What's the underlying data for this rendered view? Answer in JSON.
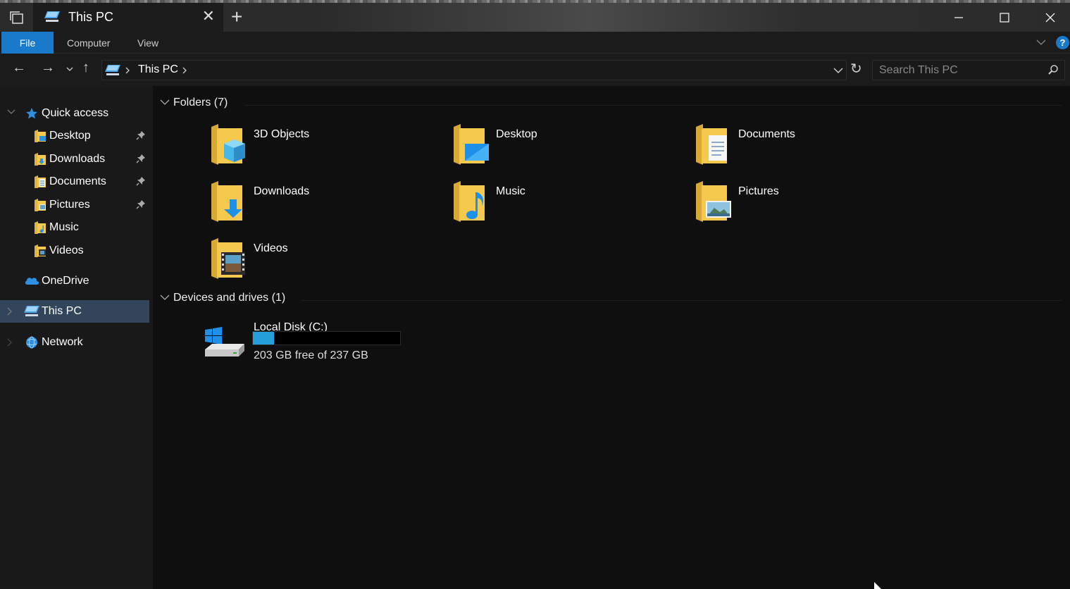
{
  "window": {
    "tab_title": "This PC",
    "tab_close": "✕",
    "tab_add": "+"
  },
  "ribbon": {
    "file": "File",
    "tabs": [
      "Computer",
      "View"
    ],
    "help": "?"
  },
  "navigation": {
    "back": "←",
    "forward": "→",
    "recent": "⌄",
    "up": "↑",
    "breadcrumb": "This PC",
    "refresh": "↻",
    "search_placeholder": "Search This PC"
  },
  "sidebar": {
    "quick_access": "Quick access",
    "items": [
      {
        "label": "Desktop",
        "pinned": true
      },
      {
        "label": "Downloads",
        "pinned": true
      },
      {
        "label": "Documents",
        "pinned": true
      },
      {
        "label": "Pictures",
        "pinned": true
      },
      {
        "label": "Music",
        "pinned": false
      },
      {
        "label": "Videos",
        "pinned": false
      }
    ],
    "onedrive": "OneDrive",
    "this_pc": "This PC",
    "network": "Network"
  },
  "content": {
    "folders_header": "Folders (7)",
    "folders": [
      {
        "label": "3D Objects",
        "icon": "3d-objects-folder-icon"
      },
      {
        "label": "Desktop",
        "icon": "desktop-folder-icon"
      },
      {
        "label": "Documents",
        "icon": "documents-folder-icon"
      },
      {
        "label": "Downloads",
        "icon": "downloads-folder-icon"
      },
      {
        "label": "Music",
        "icon": "music-folder-icon"
      },
      {
        "label": "Pictures",
        "icon": "pictures-folder-icon"
      },
      {
        "label": "Videos",
        "icon": "videos-folder-icon"
      }
    ],
    "devices_header": "Devices and drives (1)",
    "drive": {
      "name": "Local Disk (C:)",
      "free_text": "203 GB free of 237 GB",
      "used_fraction": 0.144
    }
  },
  "colors": {
    "accent": "#1979ca",
    "selection": "#33455a",
    "drive_fill": "#26a0da",
    "folder_yellow": "#f5c94e"
  }
}
